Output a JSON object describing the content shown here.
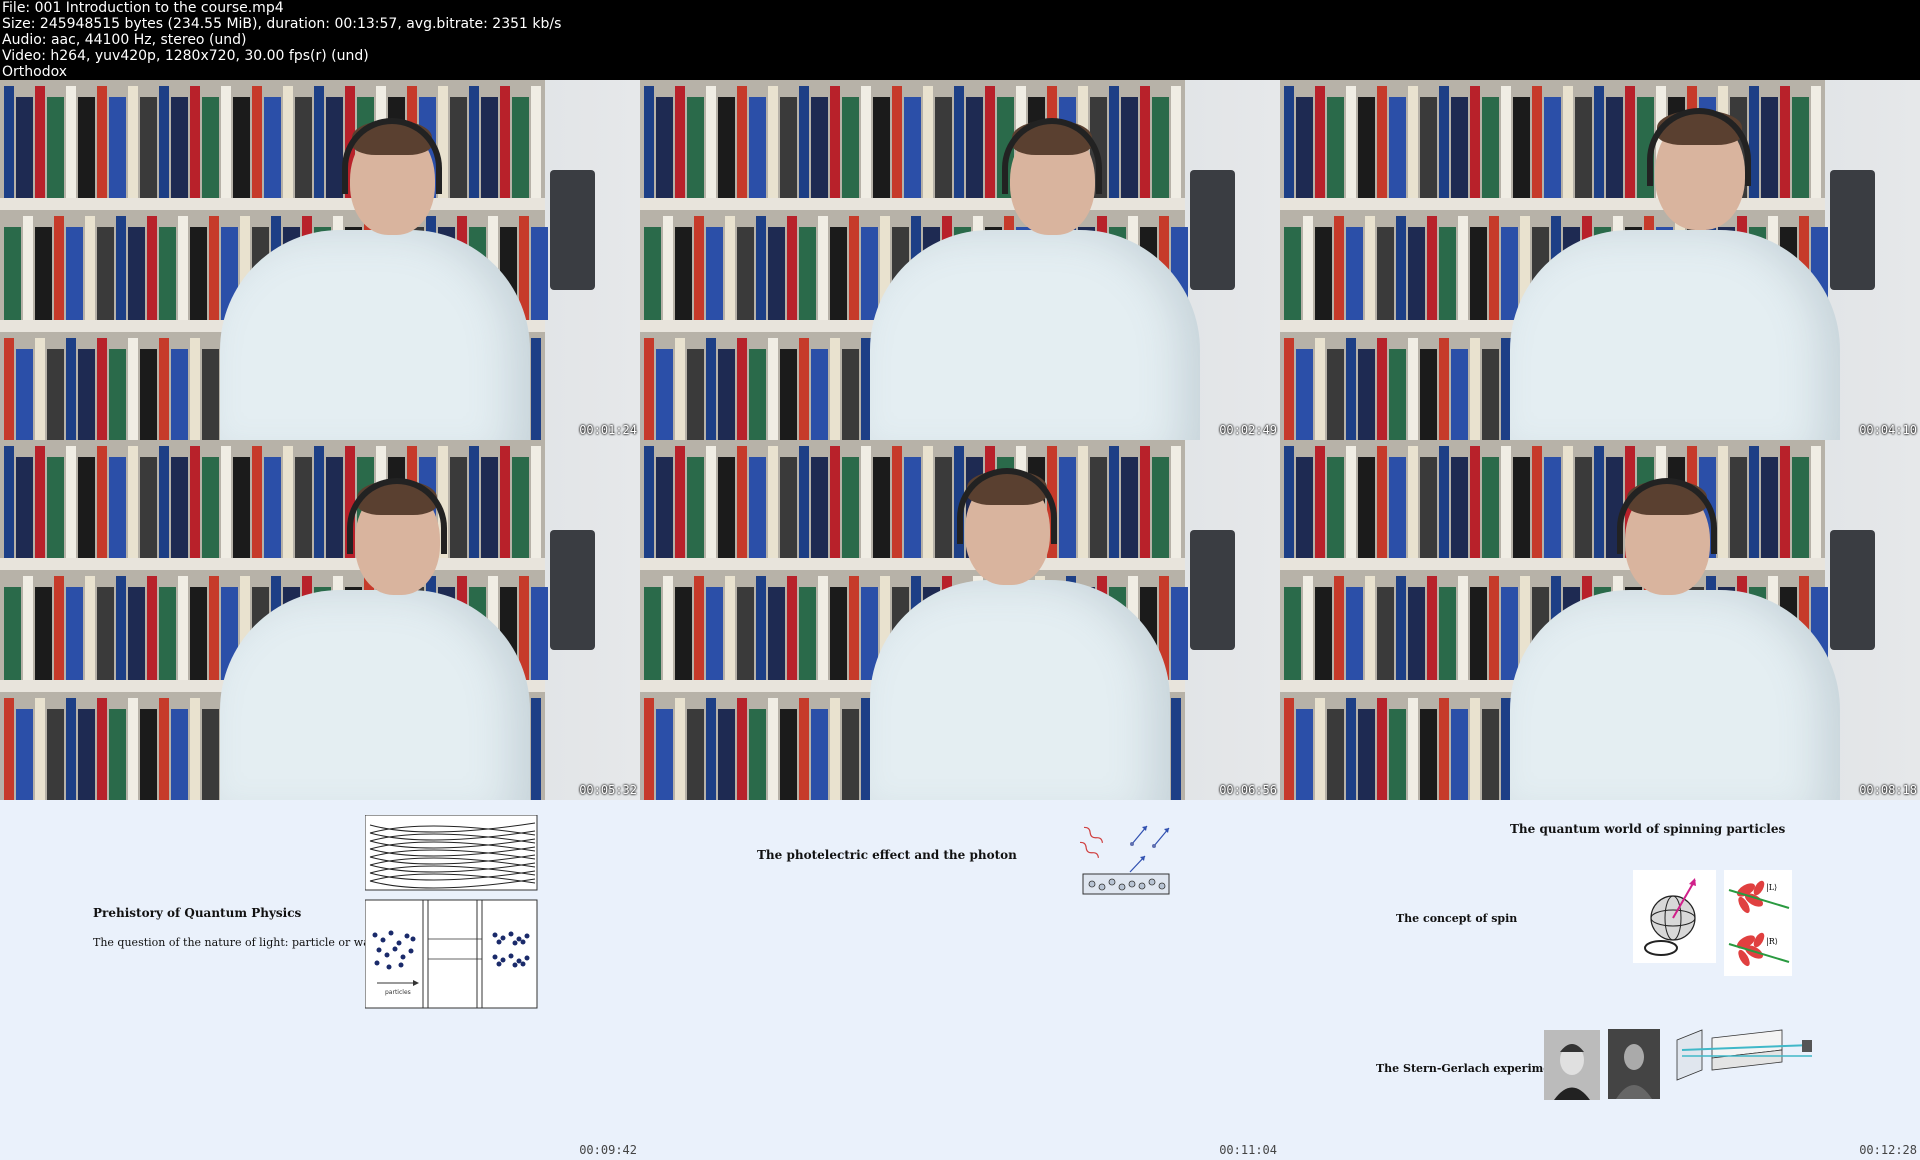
{
  "file_info": {
    "file": "File: 001 Introduction to the course.mp4",
    "size": "Size: 245948515 bytes (234.55 MiB), duration: 00:13:57, avg.bitrate: 2351 kb/s",
    "audio": "Audio: aac, 44100 Hz, stereo (und)",
    "video": "Video: h264, yuv420p, 1280x720, 30.00 fps(r) (und)",
    "tag": "Orthodox"
  },
  "thumbnails": [
    {
      "timestamp": "00:01:24"
    },
    {
      "timestamp": "00:02:49"
    },
    {
      "timestamp": "00:04:10"
    },
    {
      "timestamp": "00:05:32"
    },
    {
      "timestamp": "00:06:56"
    },
    {
      "timestamp": "00:08:18"
    },
    {
      "timestamp": "00:09:42"
    },
    {
      "timestamp": "00:11:04"
    },
    {
      "timestamp": "00:12:28"
    }
  ],
  "slides": {
    "s7": {
      "title": "Prehistory of Quantum Physics",
      "text": "The question of the nature of light: particle or wave?",
      "label": "particles"
    },
    "s8": {
      "title": "The photelectric effect and the photon"
    },
    "s9": {
      "title": "The quantum world of spinning particles",
      "item1": "The concept of spin",
      "item2": "The Stern-Gerlach experiment",
      "ket_l": "|L⟩",
      "ket_r": "|R⟩"
    }
  },
  "colors": {
    "slide_bg": "#eaf1fb",
    "shirt": "#e4eef2",
    "wall": "#d8dde0"
  }
}
